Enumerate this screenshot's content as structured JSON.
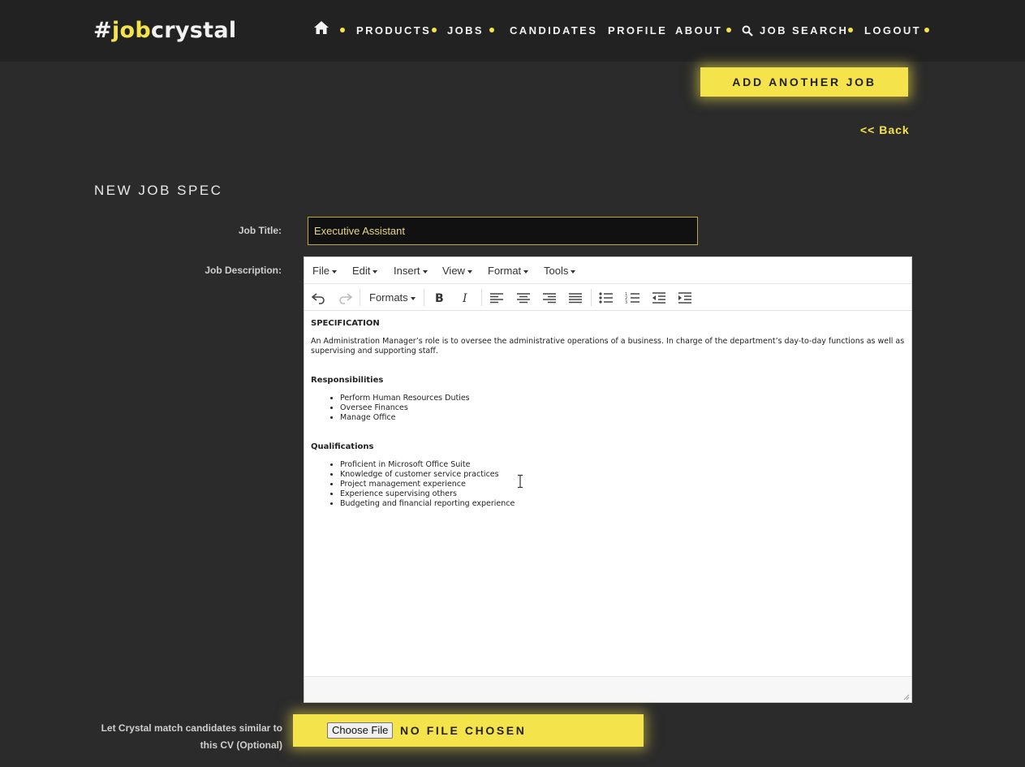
{
  "nav": {
    "logo": {
      "hash": "#",
      "job": "job",
      "crystal": "crystal"
    },
    "items": [
      "PRODUCTS",
      "JOBS",
      "CANDIDATES",
      "PROFILE",
      "ABOUT",
      "JOB SEARCH",
      "LOGOUT"
    ],
    "icons": [
      "home-icon",
      "search-icon"
    ]
  },
  "actions": {
    "add_job": "ADD ANOTHER JOB",
    "back": "<< Back"
  },
  "form": {
    "title": "NEW JOB SPEC",
    "job_title_label": "Job Title:",
    "job_title_value": "Executive Assistant",
    "job_description_label": "Job Description:",
    "cv_label": "Let Crystal match candidates similar to this CV (Optional)",
    "choose_file": "Choose File",
    "no_file": "NO FILE CHOSEN"
  },
  "editor": {
    "menus": [
      "File",
      "Edit",
      "Insert",
      "View",
      "Format",
      "Tools"
    ],
    "formats_label": "Formats",
    "toolbar_icons": [
      "undo-icon",
      "redo-icon",
      "bold-icon",
      "italic-icon",
      "align-left-icon",
      "align-center-icon",
      "align-right-icon",
      "justify-icon",
      "bullet-list-icon",
      "numbered-list-icon",
      "outdent-icon",
      "indent-icon"
    ],
    "content": {
      "spec_heading": "SPECIFICATION",
      "spec_text": "An Administration Manager’s role is to oversee the administrative operations of a business. In charge of the department’s day-to-day functions as well as supervising and supporting staff.",
      "resp_heading": "Responsibilities",
      "responsibilities": [
        "Perform Human Resources Duties",
        "Oversee Finances",
        "Manage Office"
      ],
      "qual_heading": "Qualifications",
      "qualifications": [
        "Proficient in Microsoft Office Suite",
        "Knowledge of customer service practices",
        "Project management experience",
        "Experience supervising others",
        "Budgeting and financial reporting experience"
      ]
    }
  },
  "colors": {
    "accent": "#f5e34b",
    "background": "#2b2b2b",
    "navbar": "#222222"
  }
}
